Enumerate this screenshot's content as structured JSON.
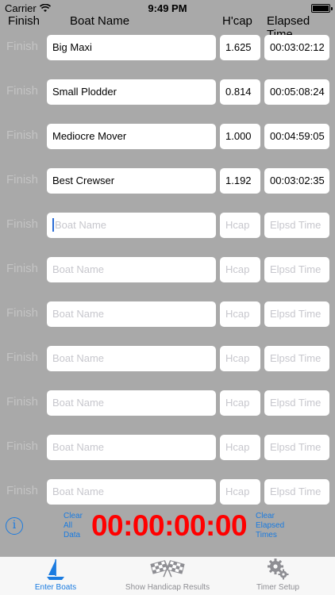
{
  "status": {
    "carrier": "Carrier",
    "time": "9:49 PM"
  },
  "header": {
    "finish": "Finish",
    "boat_name": "Boat Name",
    "hcap": "H'cap",
    "elapsed": "Elapsed Time"
  },
  "rows": [
    {
      "finish": "Finish",
      "name": "Big Maxi",
      "hcap": "1.625",
      "elapsed": "00:03:02:12"
    },
    {
      "finish": "Finish",
      "name": "Small Plodder",
      "hcap": "0.814",
      "elapsed": "00:05:08:24"
    },
    {
      "finish": "Finish",
      "name": "Mediocre Mover",
      "hcap": "1.000",
      "elapsed": "00:04:59:05"
    },
    {
      "finish": "Finish",
      "name": "Best Crewser",
      "hcap": "1.192",
      "elapsed": "00:03:02:35"
    },
    {
      "finish": "Finish",
      "name": "",
      "hcap": "",
      "elapsed": ""
    },
    {
      "finish": "Finish",
      "name": "",
      "hcap": "",
      "elapsed": ""
    },
    {
      "finish": "Finish",
      "name": "",
      "hcap": "",
      "elapsed": ""
    },
    {
      "finish": "Finish",
      "name": "",
      "hcap": "",
      "elapsed": ""
    },
    {
      "finish": "Finish",
      "name": "",
      "hcap": "",
      "elapsed": ""
    },
    {
      "finish": "Finish",
      "name": "",
      "hcap": "",
      "elapsed": ""
    },
    {
      "finish": "Finish",
      "name": "",
      "hcap": "",
      "elapsed": ""
    }
  ],
  "placeholders": {
    "name": "Boat Name",
    "hcap": "Hcap",
    "elapsed": "Elpsd Time"
  },
  "controls": {
    "clear_all": "Clear All Data",
    "timer": "00:00:00:00",
    "clear_elapsed": "Clear Elapsed Times"
  },
  "tabs": [
    {
      "label": "Enter Boats",
      "icon": "sailboat-icon",
      "active": true
    },
    {
      "label": "Show Handicap Results",
      "icon": "checkered-flags-icon",
      "active": false
    },
    {
      "label": "Timer Setup",
      "icon": "gear-icon",
      "active": false
    }
  ],
  "colors": {
    "accent": "#1a7be0",
    "timer": "#ff0000",
    "background": "#a9a9a9"
  }
}
